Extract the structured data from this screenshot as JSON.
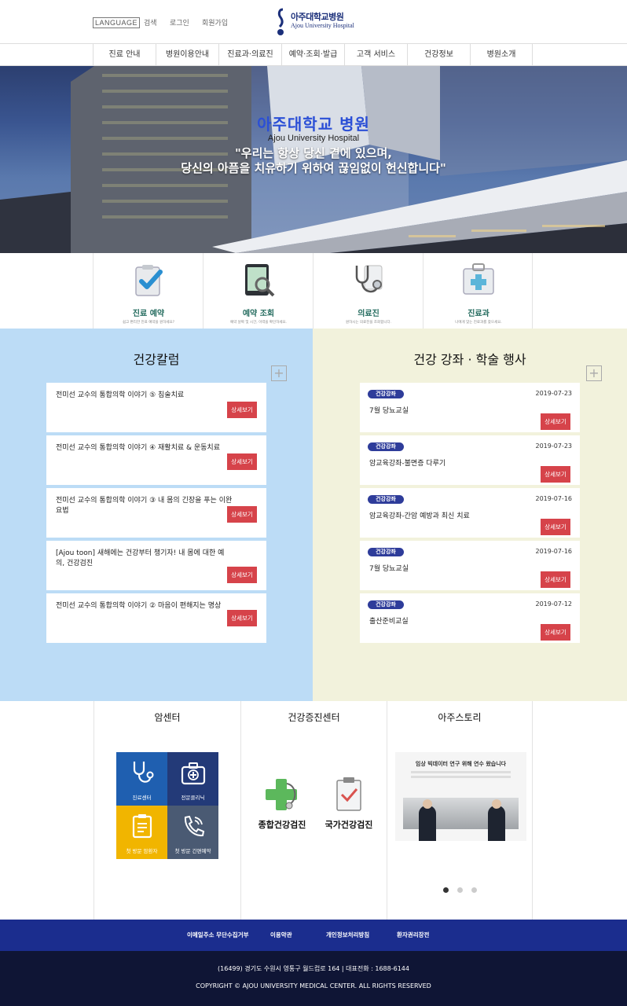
{
  "header": {
    "language_label": "LANGUAGE",
    "links": [
      "검색",
      "로그인",
      "회원가입"
    ],
    "logo_kr": "아주대학교병원",
    "logo_en": "Ajou University Hospital"
  },
  "nav": [
    "진료 안내",
    "병원이용안내",
    "진료과·의료진",
    "예약·조회·발급",
    "고객 서비스",
    "건강정보",
    "병원소개"
  ],
  "hero": {
    "title": "아주대학교 병원",
    "subtitle": "Ajou University Hospital",
    "quote_line1": "\"우리는 항상 당신 곁에 있으며,",
    "quote_line2": "당신의 아픔을 치유하기 위하여 끊임없이 헌신합니다\""
  },
  "quick_menu": [
    {
      "label": "진료 예약",
      "desc": "쉽고 편리한 진료 예약을 원하세요?",
      "icon": "clipboard-check-icon"
    },
    {
      "label": "예약 조회",
      "desc": "예약 날짜 및 시간, 이력을 확인하세요.",
      "icon": "tablet-search-icon"
    },
    {
      "label": "의료진",
      "desc": "원하시는 의료진을 조회합니다.",
      "icon": "stethoscope-icon"
    },
    {
      "label": "진료과",
      "desc": "나에게 맞는 진료과를 찾으세요.",
      "icon": "first-aid-kit-icon"
    }
  ],
  "health_column": {
    "title": "건강칼럼",
    "more_label": "상세보기",
    "items": [
      "전미선 교수의 통합의학 이야기 ⑤ 침술치료",
      "전미선 교수의 통합의학 이야기 ④ 재활치료 & 운동치료",
      "전미선 교수의 통합의학 이야기 ③ 내 몸의 긴장을 푸는 이완요법",
      "[Ajou toon] 새해에는 건강부터 챙기자! 내 몸에 대한 예의, 건강검진",
      "전미선 교수의 통합의학 이야기 ② 마음이 편해지는 명상"
    ]
  },
  "events": {
    "title": "건강 강좌 · 학술 행사",
    "more_label": "상세보기",
    "items": [
      {
        "badge": "건강강좌",
        "date": "2019-07-23",
        "title": "7월 당뇨교실"
      },
      {
        "badge": "건강강좌",
        "date": "2019-07-23",
        "title": "암교육강좌-불면증 다루기"
      },
      {
        "badge": "건강강좌",
        "date": "2019-07-16",
        "title": "암교육강좌-간암 예방과 최신 치료"
      },
      {
        "badge": "건강강좌",
        "date": "2019-07-16",
        "title": "7월 당뇨교실"
      },
      {
        "badge": "건강강좌",
        "date": "2019-07-12",
        "title": "출산준비교실"
      }
    ]
  },
  "cancer_center": {
    "title": "암센터",
    "tiles": [
      {
        "label": "진료센터",
        "color": "#1f5fb0",
        "icon": "stethoscope-icon"
      },
      {
        "label": "전문클리닉",
        "color": "#233a78",
        "icon": "medical-bag-icon"
      },
      {
        "label": "첫 방문 암환자",
        "color": "#f1b500",
        "icon": "clipboard-icon"
      },
      {
        "label": "첫 방문 간편예약",
        "color": "#4a5a73",
        "icon": "phone-icon"
      }
    ]
  },
  "checkup_center": {
    "title": "건강증진센터",
    "items": [
      {
        "label": "종합건강검진",
        "icon": "cross-stethoscope-icon"
      },
      {
        "label": "국가건강검진",
        "icon": "clipboard-check-icon"
      }
    ]
  },
  "ajou_story": {
    "title": "아주스토리",
    "image_caption": "임상 빅데이터 연구 위해 연수 왔습니다"
  },
  "footer": {
    "links": [
      "이메일주소 무단수집거부",
      "이용약관",
      "개인정보처리방침",
      "환자권리장전"
    ],
    "address": "(16499) 경기도 수원시 영통구 월드컵로 164 | 대표전화 : 1688-6144",
    "copyright": "COPYRIGHT © AJOU UNIVERSITY MEDICAL CENTER. ALL RIGHTS RESERVED"
  }
}
